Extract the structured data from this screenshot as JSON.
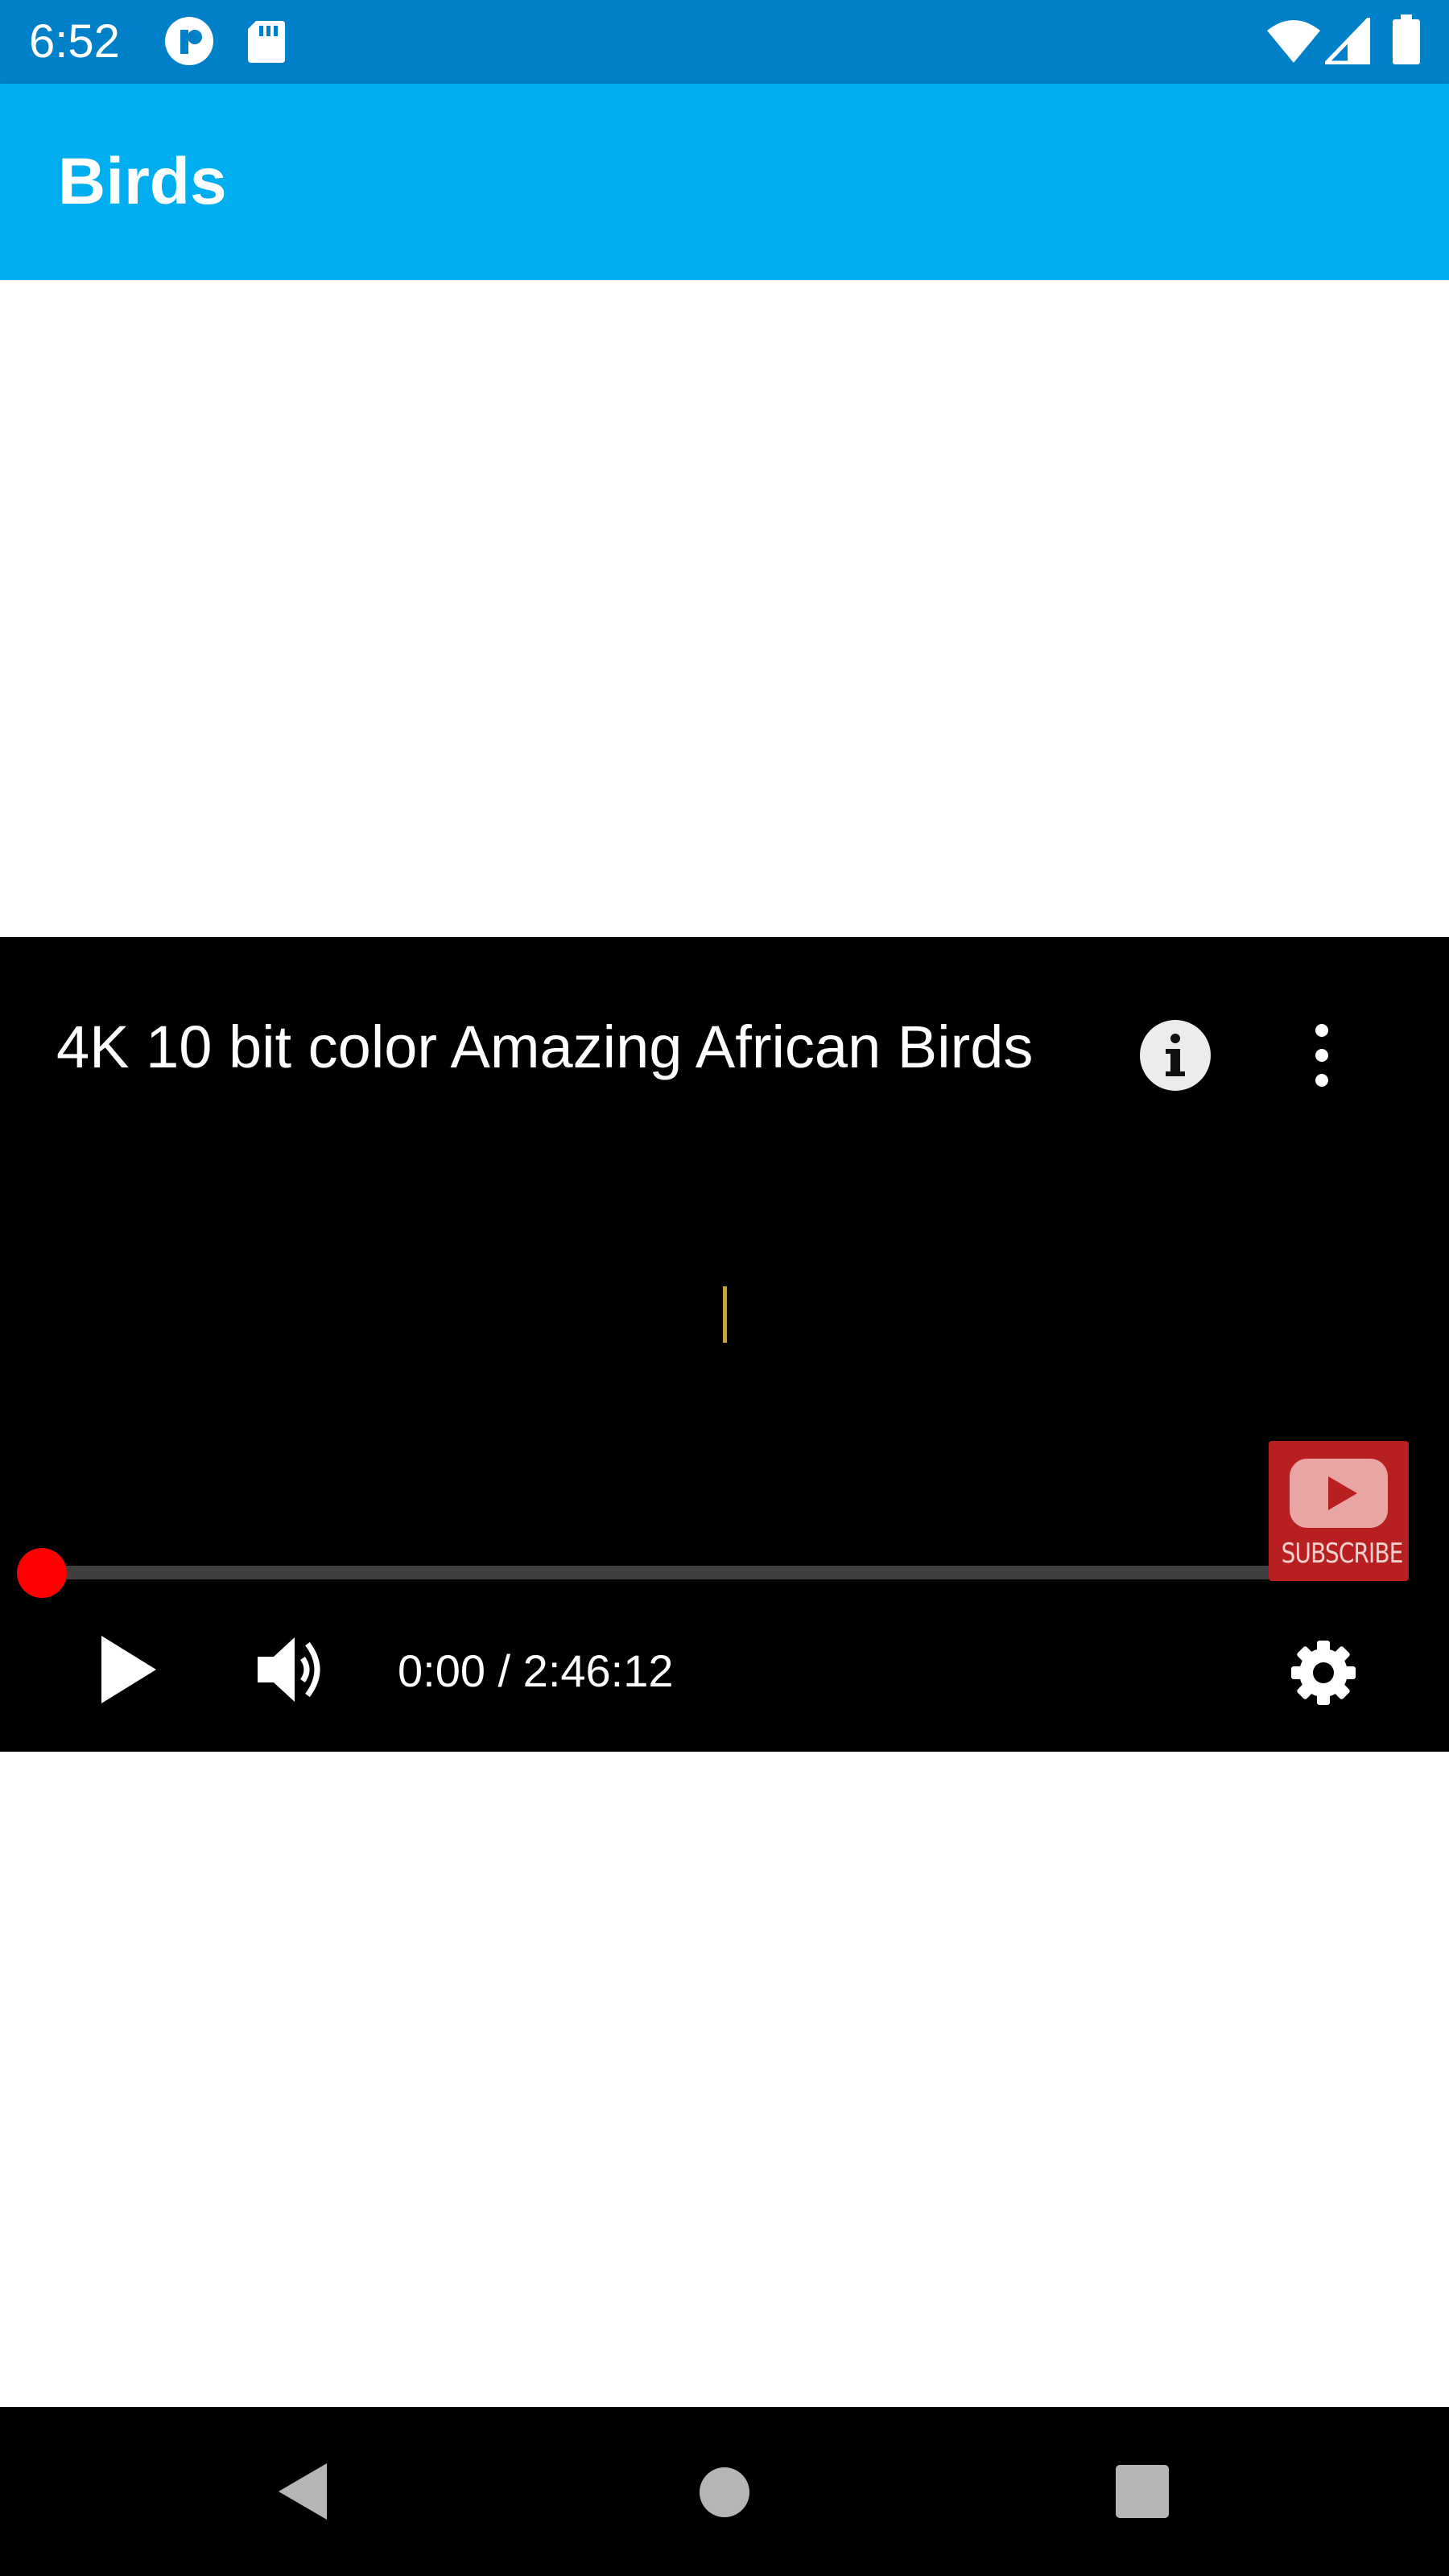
{
  "status_bar": {
    "time": "6:52",
    "icons": [
      "app-notification-icon",
      "sd-card-icon",
      "wifi-icon",
      "cellular-signal-icon",
      "battery-icon"
    ]
  },
  "app_bar": {
    "title": "Birds",
    "color": "#00aeef"
  },
  "player": {
    "title": "4K 10 bit color Amazing African Birds",
    "current_time": "0:00",
    "duration": "2:46:12",
    "time_display": "0:00 / 2:46:12",
    "progress": 0,
    "subscribe_label": "SUBSCRIBE",
    "accent_color": "#ff0000"
  },
  "navigation": {
    "buttons": [
      "back-icon",
      "home-icon",
      "recents-icon"
    ]
  }
}
